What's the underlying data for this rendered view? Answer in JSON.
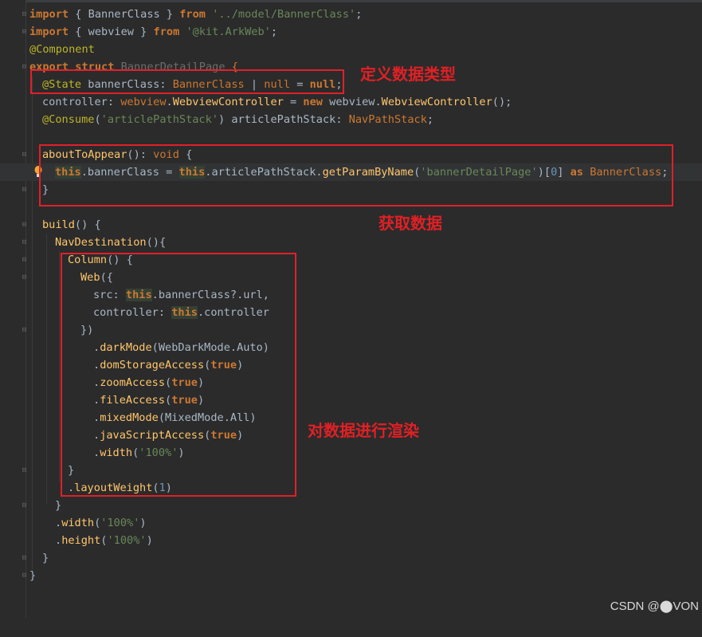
{
  "editor": {
    "lines": [
      "import { BannerClass } from '../model/BannerClass';",
      "import { webview } from '@kit.ArkWeb';",
      "@Component",
      "export struct BannerDetailPage {",
      "  @State bannerClass: BannerClass | null = null;",
      "  controller: webview.WebviewController = new webview.WebviewController();",
      "  @Consume('articlePathStack') articlePathStack: NavPathStack;",
      "",
      "  aboutToAppear(): void {",
      "    this.bannerClass = this.articlePathStack.getParamByName('bannerDetailPage')[0] as BannerClass;",
      "  }",
      "",
      "  build() {",
      "    NavDestination(){",
      "      Column() {",
      "        Web({",
      "          src: this.bannerClass?.url,",
      "          controller: this.controller",
      "        })",
      "          .darkMode(WebDarkMode.Auto)",
      "          .domStorageAccess(true)",
      "          .zoomAccess(true)",
      "          .fileAccess(true)",
      "          .mixedMode(MixedMode.All)",
      "          .javaScriptAccess(true)",
      "          .width('100%')",
      "      }",
      "      .layoutWeight(1)",
      "    }",
      "    .width('100%')",
      "    .height('100%')",
      "  }",
      "}"
    ]
  },
  "annotations": {
    "define_type": "定义数据类型",
    "get_data": "获取数据",
    "render_data": "对数据进行渲染"
  },
  "icons": {
    "fold": "fold-marker-icon",
    "bulb": "lightbulb-icon"
  },
  "colors": {
    "annotation": "#e0202a",
    "background": "#2b2b2b"
  },
  "watermark": "CSDN @⬤VON"
}
